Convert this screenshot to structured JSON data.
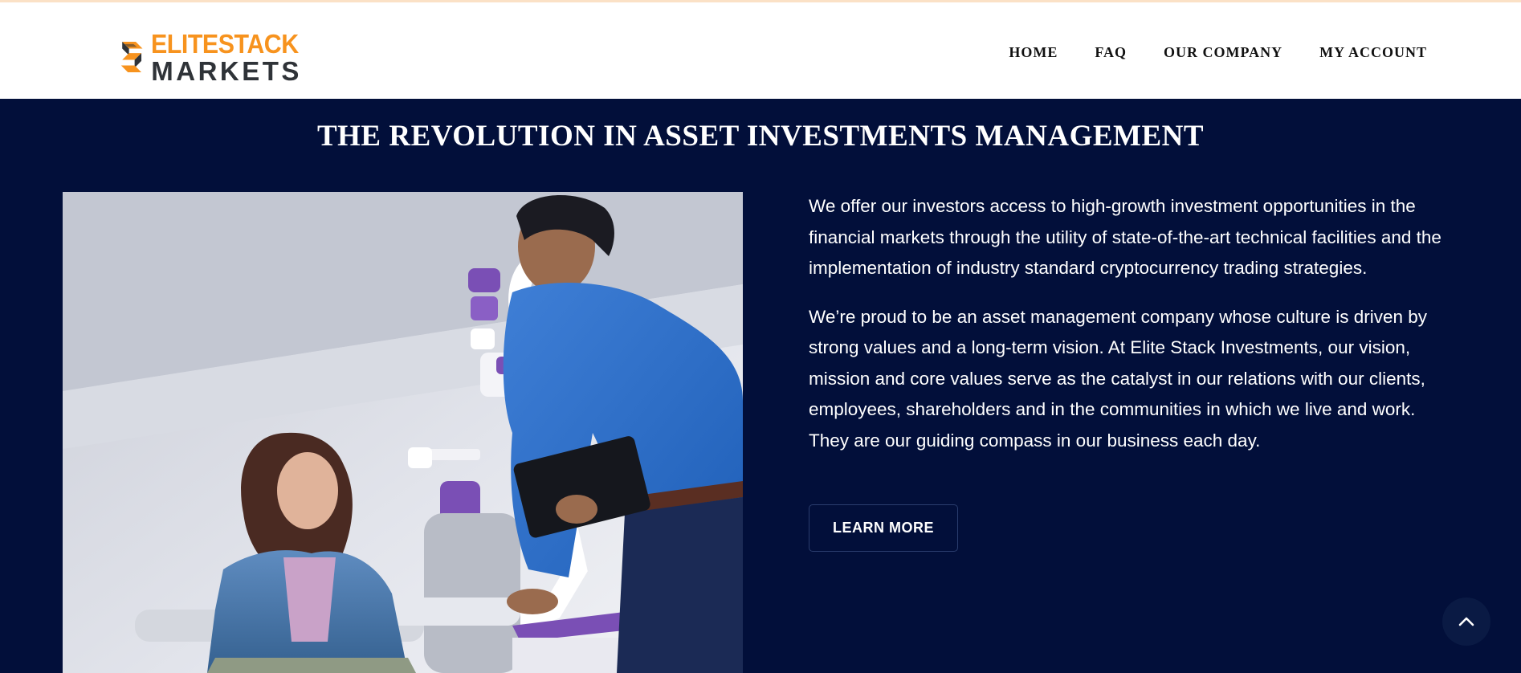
{
  "brand": {
    "line1": "ELITESTACK",
    "line2": "MARKETS",
    "colors": {
      "orange": "#f7931e",
      "dark": "#2f3338"
    }
  },
  "nav": {
    "home": "HOME",
    "faq": "FAQ",
    "company": "OUR COMPANY",
    "account": "MY ACCOUNT"
  },
  "hero": {
    "title": "THE REVOLUTION IN ASSET INVESTMENTS MANAGEMENT",
    "paragraph1": "We offer our investors access to high-growth investment opportunities in the financial markets through the utility of state-of-the-art technical facilities and the implementation of industry standard cryptocurrency trading strategies.",
    "paragraph2": "We’re proud to be an asset management company whose culture is driven by strong values and a long-term vision. At Elite Stack Investments, our vision, mission and core values serve as the catalyst in our relations with our clients, employees, shareholders and in the communities in which we live and work. They are our guiding compass in our business each day.",
    "button": "LEARN MORE",
    "image_icon": "photo-clinic-consultation"
  },
  "scroll_top_icon": "chevron-up-icon",
  "theme": {
    "background": "#020f3a",
    "header_bg": "#ffffff",
    "accent": "#f7931e"
  }
}
